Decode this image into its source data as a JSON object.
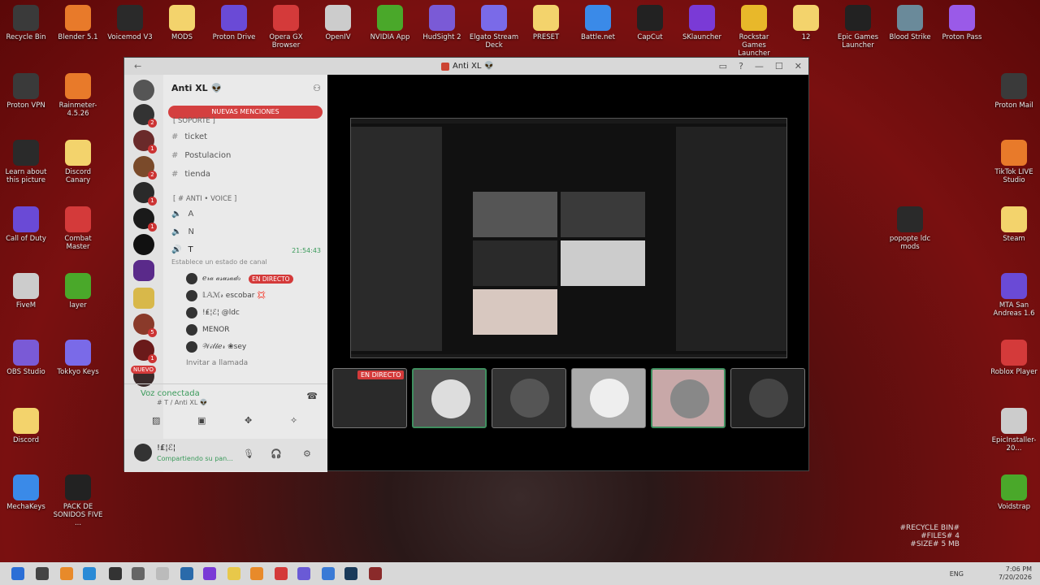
{
  "desktop": {
    "top_row": [
      "Recycle Bin",
      "Blender 5.1",
      "Voicemod V3",
      "MODS",
      "Proton Drive",
      "Opera GX Browser",
      "OpenIV",
      "NVIDIA App",
      "HudSight 2",
      "Elgato Stream Deck",
      "PRESET",
      "Battle.net",
      "CapCut",
      "SKlauncher",
      "Rockstar Games Launcher",
      "12",
      "Epic Games Launcher",
      "Blood Strike",
      "Proton Pass"
    ],
    "left_col": [
      "Proton VPN",
      "Rainmeter-4.5.26",
      "Learn about this picture",
      "Discord Canary",
      "Call of Duty",
      "Combat Master",
      "FiveM",
      "layer",
      "OBS Studio",
      "Tokkyo Keys",
      "Discord",
      "MechaKeys",
      "PACK DE SONIDOS FIVE ..."
    ],
    "right_col": [
      "Proton Mail",
      "TikTok LIVE Studio",
      "popopte ldc mods",
      "Steam",
      "MTA San Andreas 1.6",
      "Roblox Player",
      "EpicInstaller-20...",
      "Voidstrap"
    ],
    "recycle_info": [
      "#RECYCLE BIN#",
      "#FILES# 4",
      "#SIZE# 5 MB"
    ]
  },
  "window": {
    "title": "Anti XL 👽",
    "back": "←"
  },
  "discord": {
    "server_name": "Anti XL 👽",
    "mentions_banner": "NUEVAS MENCIONES",
    "guild_badge_new": "NUEVO",
    "categories": [
      "[ SOPORTE ]",
      "[ # ANTI • VOICE ]"
    ],
    "text_channels": [
      "ticket",
      "Postulacion",
      "tienda"
    ],
    "voice_channels": [
      "A",
      "N",
      "T"
    ],
    "active_time": "21:54:43",
    "status_placeholder": "Establece un estado de canal",
    "voice_users": [
      {
        "name": "ℯ𝓇𝒶 𝒶𝓈𝓊𝓈𝒶𝒹ℴ",
        "live": "EN DIRECTO"
      },
      {
        "name": "𝕃𝔸ℳ𝓇 escobar 💢",
        "live": ""
      },
      {
        "name": "!₤¦ℰ¦ @ldc",
        "live": ""
      },
      {
        "name": "MENOR",
        "live": ""
      },
      {
        "name": "𝒲𝒾𝓁𝒷ℯ𝓇 ❀sey",
        "live": ""
      }
    ],
    "invite": "Invitar a llamada",
    "voice_connected": "Voz conectada",
    "voice_location": "# T / Anti XL 👽",
    "user_name": "!₤¦ℰ¦",
    "user_status": "Compartiendo su pan..."
  },
  "stream": {
    "live_label": "EN DIRECTO"
  },
  "taskbar": {
    "lang": "ENG",
    "time": "7:06 PM",
    "date": "7/20/2026"
  }
}
